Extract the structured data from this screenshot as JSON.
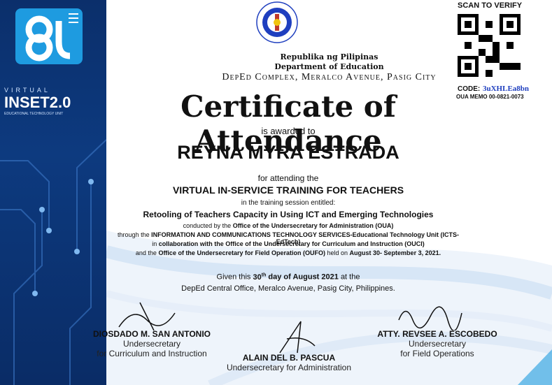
{
  "brand": {
    "logo_virtual": "VIRTUAL",
    "logo_inset": "INSET2.0",
    "logo_sub": "EDUCATIONAL TECHNOLOGY UNIT"
  },
  "verify": {
    "scan_label": "SCAN TO VERIFY",
    "code_label": "CODE:",
    "code_value": "3uXHLEa8bn",
    "memo": "OUA MEMO 00-0821-0073"
  },
  "seal": {
    "ring_text": "KAGAWARAN NG EDUKASYON",
    "bottom_text": "REPUBLIKA NG PILIPINAS"
  },
  "header": {
    "republic": "Republika ng Pilipinas",
    "department": "Department of Education",
    "address": "DepEd Complex, Meralco Avenue, Pasig City"
  },
  "certificate": {
    "title": "Certificate of Attendance",
    "awarded": "is awarded to",
    "recipient": "REYNA MYRA ESTRADA",
    "for_attending": "for attending the",
    "program": "VIRTUAL IN-SERVICE TRAINING FOR TEACHERS",
    "session_intro": "in the training session entitled:",
    "session_title": "Retooling of Teachers Capacity in Using ICT and Emerging Technologies",
    "line1_pre": "conducted by the",
    "line1_b": "Office of the Undersecretary for Administration (OUA)",
    "line2_pre": "through the",
    "line2_b": "INFORMATION AND COMMUNICATIONS TECHNOLOGY SERVICES-Educational Technology Unit  (ICTS-EdTech)",
    "line3_pre": "in",
    "line3_b": "collaboration with the Office of the Undersecretary for Curriculum and Instruction (OUCI)",
    "line4_pre": "and  the",
    "line4_b": "Office of the Undersecretary for Field Operation (OUFO)",
    "line4_mid": "held on",
    "line4_date": "August 30- September 3, 2021.",
    "given_pre": "Given this",
    "given_day": "30",
    "given_sup": "th",
    "given_b": "day of August 2021",
    "given_post": "at the",
    "venue": "DepEd Central Office, Meralco Avenue, Pasig City, Philippines."
  },
  "signatories": [
    {
      "name": "DIOSDADO M. SAN ANTONIO",
      "role1": "Undersecretary",
      "role2": "for Curriculum and Instruction"
    },
    {
      "name": "ALAIN DEL B. PASCUA",
      "role1": "Undersecretary for Administration"
    },
    {
      "name": "ATTY. REVSEE A. ESCOBEDO",
      "role1": "Undersecretary",
      "role2": "for Field Operations"
    }
  ],
  "colors": {
    "navy": "#0b2f6b",
    "accent": "#1e9be0",
    "code": "#1f3fbf"
  }
}
